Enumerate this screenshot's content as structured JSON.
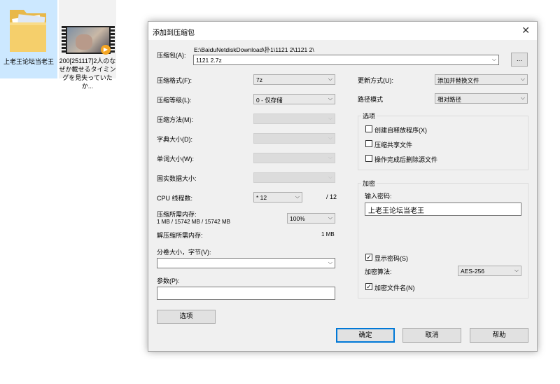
{
  "desktop": {
    "icon1_label": "上老王论坛当老王",
    "icon2_label": "200[251117]2人のなぜか載せるタイミングを見失っていたか..."
  },
  "dialog": {
    "title": "添加到压缩包",
    "archive_label": "压缩包(A):",
    "archive_path": "E:\\BaiduNetdiskDownload\\扑1\\1121 2\\1121 2\\",
    "archive_name": "1121 2.7z",
    "browse_label": "...",
    "format_label": "压缩格式(F):",
    "format_value": "7z",
    "level_label": "压缩等级(L):",
    "level_value": "0 - 仅存储",
    "method_label": "压缩方法(M):",
    "dict_label": "字典大小(D):",
    "word_label": "单词大小(W):",
    "solid_label": "固实数据大小:",
    "cpu_label": "CPU 线程数:",
    "cpu_value": "* 12",
    "cpu_max": "/ 12",
    "mem_comp_label": "压缩所需内存:",
    "mem_comp_value": "1 MB / 15742 MB / 15742 MB",
    "mem_percent": "100%",
    "mem_decomp_label": "解压缩所需内存:",
    "mem_decomp_value": "1 MB",
    "volume_label": "分卷大小，字节(V):",
    "params_label": "参数(P):",
    "options_button": "选项",
    "update_label": "更新方式(U):",
    "update_value": "添加并替换文件",
    "path_label": "路径模式",
    "path_value": "相对路径",
    "options_group": "选项",
    "opt_sfx": "创建自释放程序(X)",
    "opt_shared": "压缩共享文件",
    "opt_delete": "操作完成后删除源文件",
    "encrypt_group": "加密",
    "password_label": "输入密码:",
    "password_value": "上老王论坛当老王",
    "show_password": "显示密码(S)",
    "encrypt_method_label": "加密算法:",
    "encrypt_method_value": "AES-256",
    "encrypt_names": "加密文件名(N)",
    "ok": "确定",
    "cancel": "取消",
    "help": "帮助"
  }
}
